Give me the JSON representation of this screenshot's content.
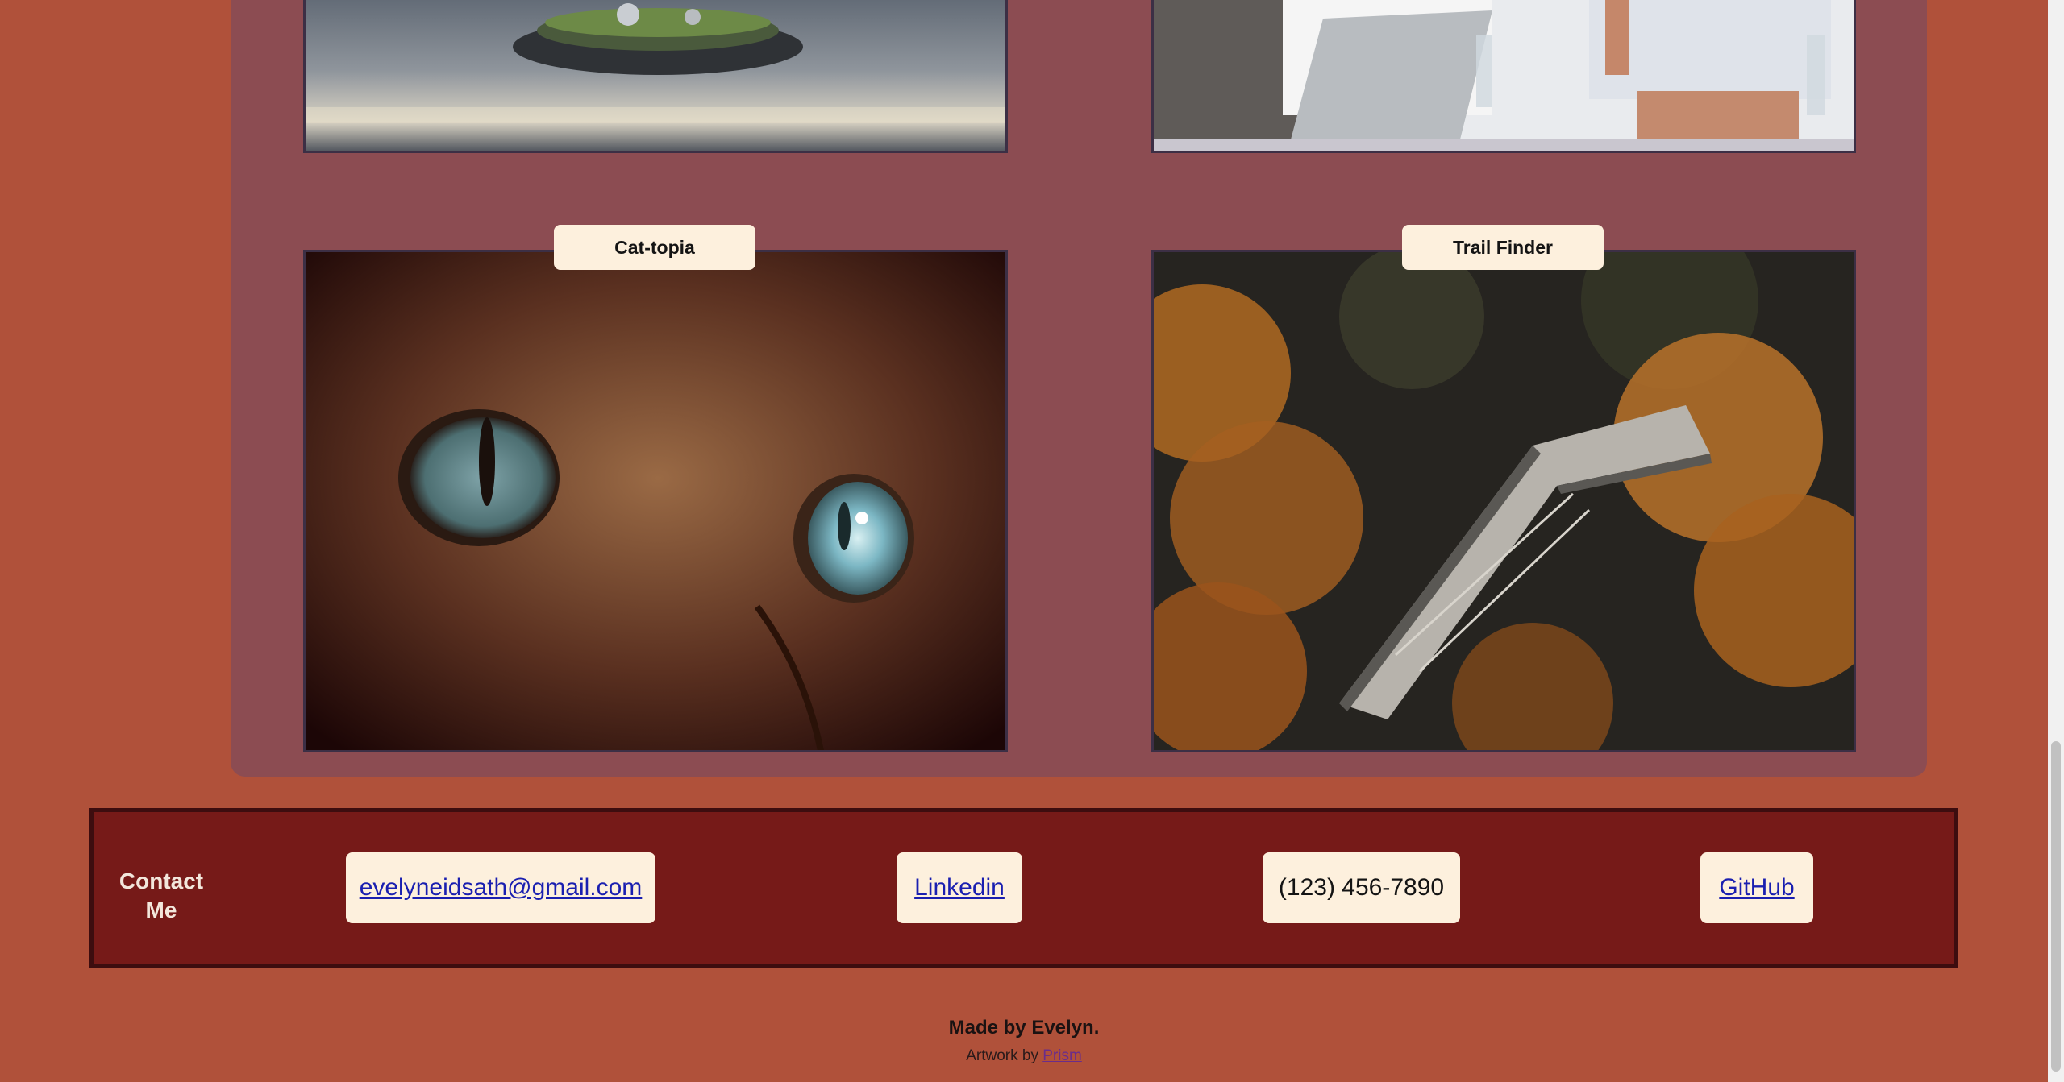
{
  "projects": [
    {
      "label": "",
      "image": "miniature-tree-terrarium-image"
    },
    {
      "label": "",
      "image": "team-meeting-laptop-image"
    },
    {
      "label": "Cat-topia",
      "image": "cat-eyes-closeup-image"
    },
    {
      "label": "Trail Finder",
      "image": "forest-boardwalk-image"
    }
  ],
  "contact": {
    "title": "Contact Me",
    "email": "evelyneidsath@gmail.com",
    "linkedin": "Linkedin",
    "phone": "(123) 456-7890",
    "github": "GitHub"
  },
  "footer": {
    "made_by": "Made by Evelyn.",
    "artwork_prefix": "Artwork by",
    "artwork_link": "Prism"
  },
  "colors": {
    "page_bg": "#b0513a",
    "panel_bg": "#8c4c52",
    "contact_bg": "#761a18",
    "card_bg": "#fdf0dd"
  }
}
